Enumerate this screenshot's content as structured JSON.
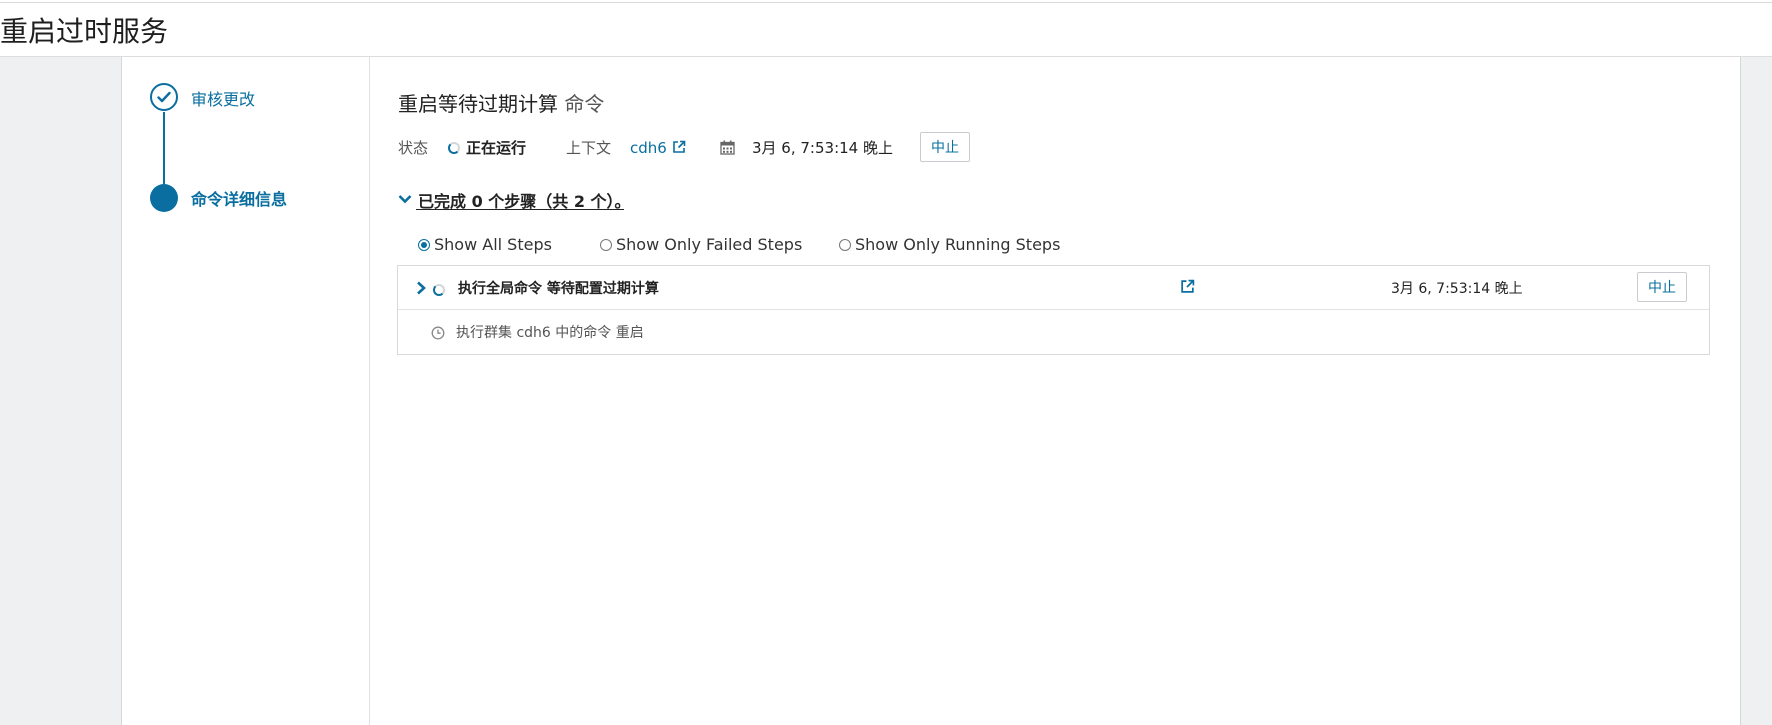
{
  "page": {
    "title": "重启过时服务"
  },
  "wizard": {
    "steps": [
      {
        "label": "审核更改",
        "state": "done"
      },
      {
        "label": "命令详细信息",
        "state": "current"
      }
    ]
  },
  "command": {
    "title": "重启等待过期计算",
    "title_suffix": "命令",
    "status_label": "状态",
    "status_value": "正在运行",
    "context_label": "上下文",
    "context_value": "cdh6",
    "timestamp": "3月 6, 7:53:14 晚上",
    "abort_label": "中止",
    "summary": "已完成 0 个步骤（共 2 个）。"
  },
  "filters": {
    "options": [
      {
        "label": "Show All Steps",
        "selected": true
      },
      {
        "label": "Show Only Failed Steps",
        "selected": false
      },
      {
        "label": "Show Only Running Steps",
        "selected": false
      }
    ]
  },
  "steps": [
    {
      "name": "执行全局命令 等待配置过期计算",
      "timestamp": "3月 6, 7:53:14 晚上",
      "abort_label": "中止"
    },
    {
      "name": "执行群集 cdh6 中的命令 重启"
    }
  ],
  "colors": {
    "accent": "#0a6fa0",
    "gutter": "#eef0f1"
  }
}
